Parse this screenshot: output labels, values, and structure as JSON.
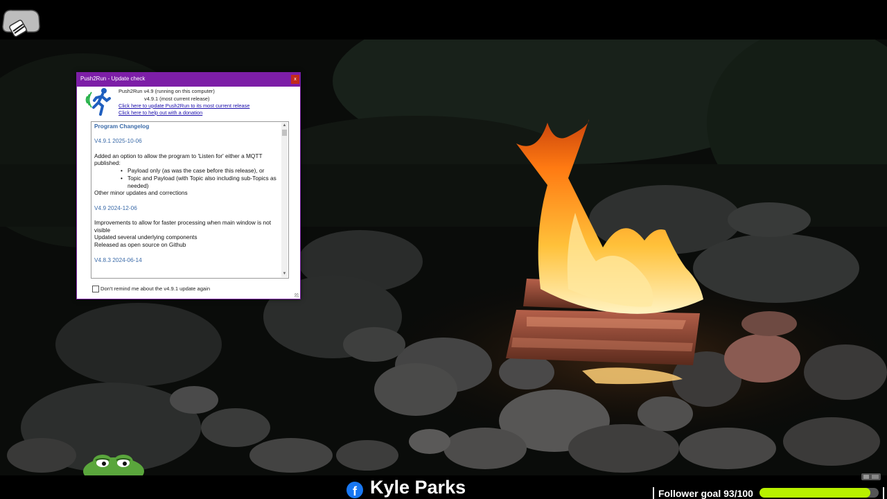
{
  "dialog": {
    "title": "Push2Run - Update check",
    "close_glyph": "x",
    "header_line1": "Push2Run v4.9 (running on this computer)",
    "header_line2": "v4.9.1 (most current release)",
    "update_link": "Click here to update Push2Run to its most current release",
    "donate_link": "Click here to help out with a donation",
    "changelog": {
      "heading": "Program Changelog",
      "entries": [
        {
          "version": "V4.9.1 2025-10-06",
          "line1": "Added an option to allow the program to 'Listen for' either a MQTT published:",
          "bullet1": "Payload only (as was the case before this release), or",
          "bullet2": "Topic and Payload (with Topic also including sub-Topics as needed)",
          "line2": "Other minor updates and corrections"
        },
        {
          "version": "V4.9 2024-12-06",
          "line1": "Improvements to allow for faster processing when main window is not visible",
          "line2": "Updated several underlying components",
          "line3": "Released as open source on Github"
        },
        {
          "version": "V4.8.3 2024-06-14"
        }
      ]
    },
    "checkbox_label": "Don't remind me about the v4.9.1 update again",
    "checkbox_checked": false
  },
  "overlay": {
    "facebook_glyph": "f",
    "streamer_name": "Kyle Parks",
    "follower_goal_label": "Follower goal 93/100",
    "follower_goal_fraction": 0.93
  },
  "icons": {
    "corner": "vr-headset-icon",
    "app": "running-man-icon",
    "social": "facebook-icon",
    "frog": "pepe-frog-icon"
  },
  "colors": {
    "titlebar": "#7d1ea7",
    "link": "#1a0dab",
    "changelog_heading": "#3a6aa8",
    "goal_fill": "#b8f000",
    "facebook": "#1877f2"
  }
}
